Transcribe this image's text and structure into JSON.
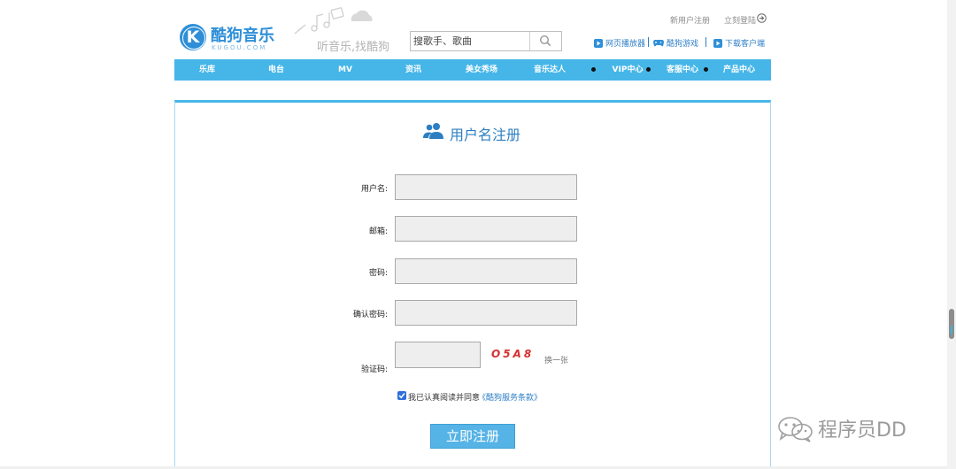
{
  "header": {
    "logo_text": "酷狗音乐",
    "logo_badge": "K",
    "logo_sub": "KUGOU.COM",
    "slogan": "听音乐,找酷狗",
    "search": {
      "placeholder": "搜歌手、歌曲"
    },
    "top_links": {
      "register": "新用户注册",
      "login": "立刻登陆"
    },
    "util_links": [
      {
        "label": "网页播放器",
        "icon": "play-icon"
      },
      {
        "label": "酷狗游戏",
        "icon": "gamepad-icon"
      },
      {
        "label": "下载客户端",
        "icon": "play-icon"
      }
    ]
  },
  "nav": {
    "items": [
      "乐库",
      "电台",
      "MV",
      "资讯",
      "美女秀场",
      "音乐达人",
      "VIP中心",
      "客服中心",
      "产品中心"
    ]
  },
  "form": {
    "title": "用户名注册",
    "fields": {
      "username": {
        "label": "用户名:",
        "value": ""
      },
      "email": {
        "label": "邮箱:",
        "value": ""
      },
      "password": {
        "label": "密码:",
        "value": ""
      },
      "confirm": {
        "label": "确认密码:",
        "value": ""
      },
      "captcha": {
        "label": "验证码:",
        "value": ""
      }
    },
    "captcha_code": "O5A8",
    "captcha_change": "换一张",
    "agree_text": "我已认真阅读并同意",
    "agree_link": "《酷狗服务条款》",
    "agree_checked": true,
    "submit_label": "立即注册"
  },
  "watermark": {
    "text": "程序员DD"
  },
  "colors": {
    "brand": "#2e8fd8",
    "nav": "#46b6e8",
    "link": "#2e7fc6",
    "captcha": "#d83030",
    "button": "#56b3e6"
  }
}
